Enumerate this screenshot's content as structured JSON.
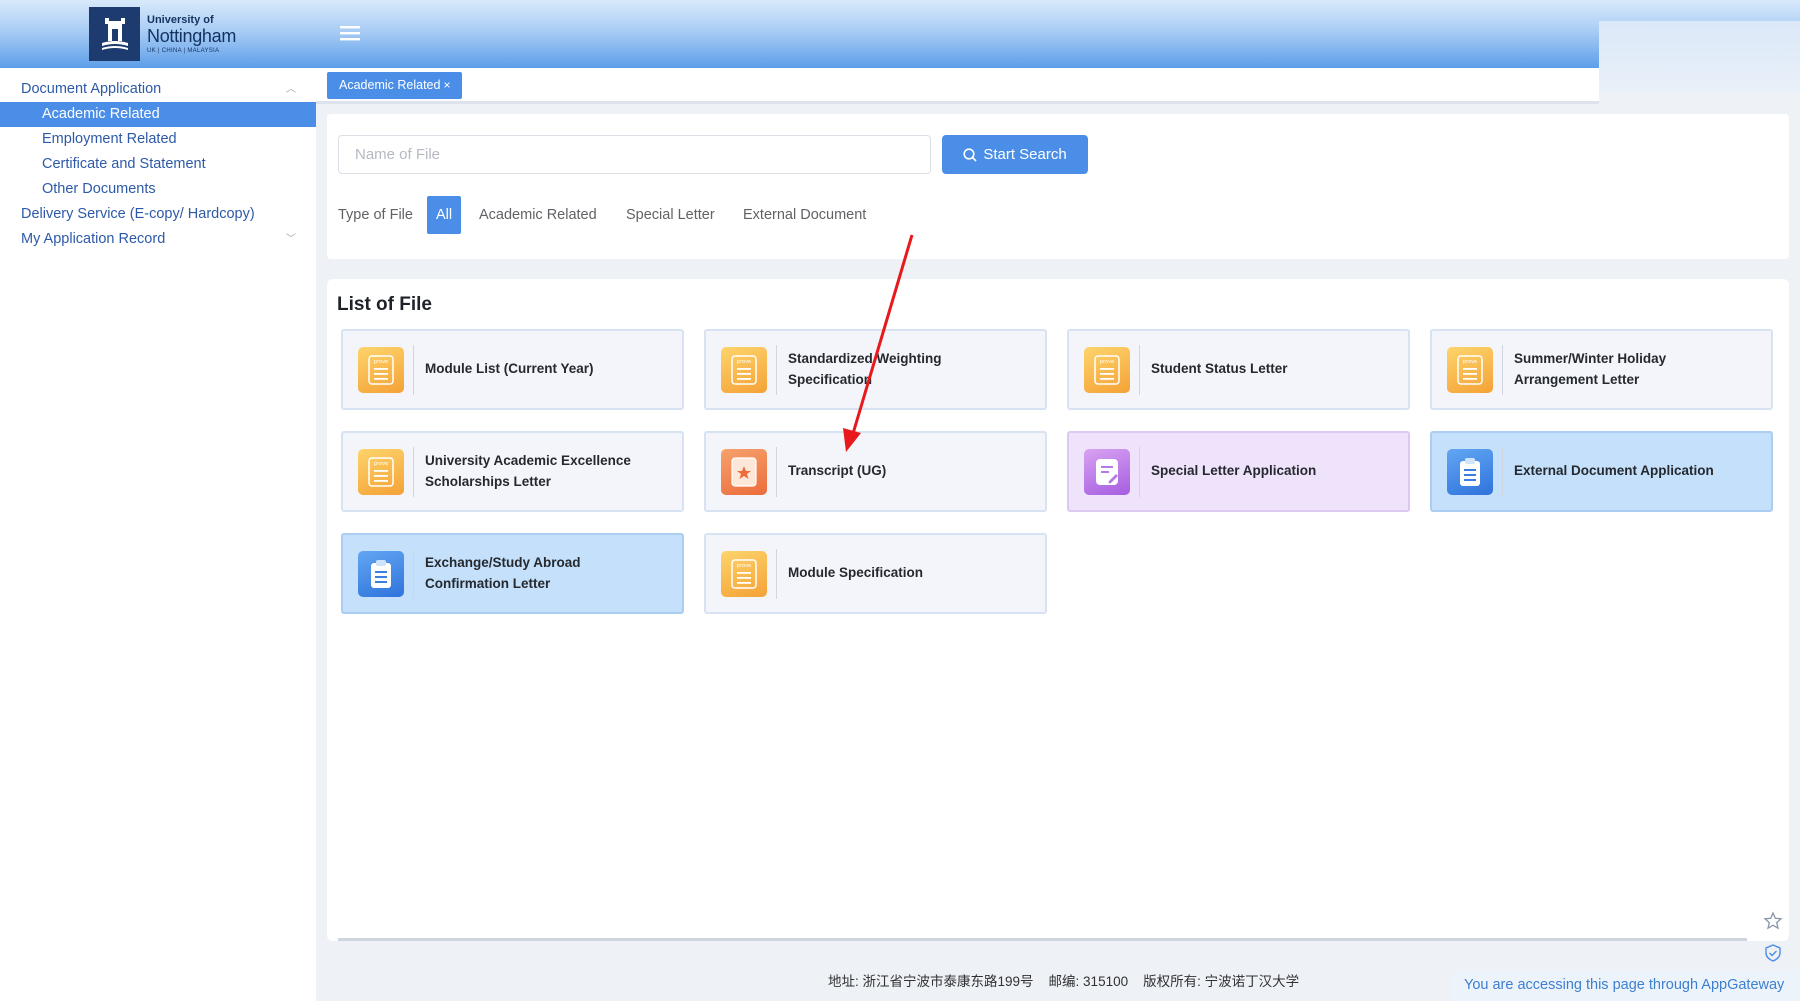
{
  "brand": {
    "university_of": "University of",
    "name": "Nottingham",
    "campuses": "UK | CHINA | MALAYSIA"
  },
  "sidebar": {
    "items": [
      {
        "label": "Document Application",
        "level": "top",
        "expanded": true
      },
      {
        "label": "Academic Related",
        "level": "sub",
        "active": true
      },
      {
        "label": "Employment Related",
        "level": "sub"
      },
      {
        "label": "Certificate and Statement",
        "level": "sub"
      },
      {
        "label": "Other Documents",
        "level": "sub"
      },
      {
        "label": "Delivery Service (E-copy/ Hardcopy)",
        "level": "top"
      },
      {
        "label": "My Application Record",
        "level": "top",
        "expanded": false
      }
    ]
  },
  "tabs": [
    {
      "label": "Academic Related",
      "close": "×"
    }
  ],
  "search": {
    "placeholder": "Name of File",
    "value": "",
    "button_label": "Start Search"
  },
  "filter": {
    "label": "Type of File",
    "options": [
      "All",
      "Academic Related",
      "Special Letter",
      "External Document"
    ],
    "selected": "All"
  },
  "list": {
    "title": "List of File",
    "cards": [
      {
        "title": "Module List (Current Year)",
        "icon": "document-orange-icon"
      },
      {
        "title": "Standardized Weighting Specification",
        "icon": "document-orange-icon"
      },
      {
        "title": "Student Status Letter",
        "icon": "document-orange-icon"
      },
      {
        "title": "Summer/Winter Holiday Arrangement Letter",
        "icon": "document-orange-icon"
      },
      {
        "title": "University Academic Excellence Scholarships Letter",
        "icon": "document-orange-icon"
      },
      {
        "title": "Transcript (UG)",
        "icon": "transcript-star-icon"
      },
      {
        "title": "Special Letter Application",
        "icon": "edit-document-purple-icon"
      },
      {
        "title": "External Document Application",
        "icon": "clipboard-blue-icon"
      },
      {
        "title": "Exchange/Study Abroad Confirmation Letter",
        "icon": "clipboard-blue-icon"
      },
      {
        "title": "Module Specification",
        "icon": "document-orange-icon"
      }
    ]
  },
  "footer": {
    "address": "地址: 浙江省宁波市泰康东路199号",
    "postcode": "邮编: 315100",
    "copyright": "版权所有: 宁波诺丁汉大学"
  },
  "gateway_notice": "You are accessing this page through AppGateway",
  "colors": {
    "primary": "#4a8ee8",
    "annotation_arrow": "#e8191c",
    "card_purple": "#efe3fb",
    "card_blue": "#c4e0fa"
  }
}
